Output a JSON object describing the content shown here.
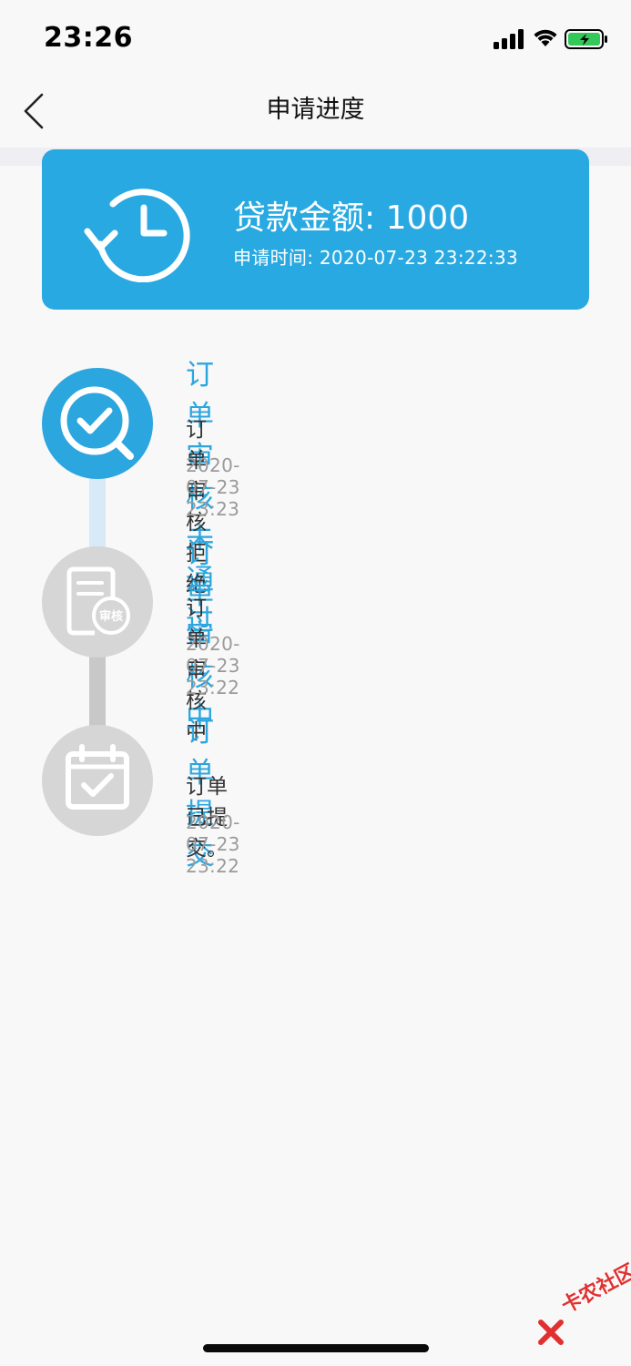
{
  "status_bar": {
    "time": "23:26",
    "icons": [
      "cellular-signal-icon",
      "wifi-icon",
      "battery-charging-icon"
    ],
    "battery_color": "#34c759"
  },
  "nav": {
    "title": "申请进度",
    "back_icon": "chevron-left-icon"
  },
  "summary": {
    "icon": "history-clock-icon",
    "loan_amount": "贷款金额: 1000",
    "apply_time": "申请时间: 2020-07-23 23:22:33",
    "background_color": "#29a9e1"
  },
  "steps": [
    {
      "title": "订单审核未通过",
      "desc": "订单审核拒绝",
      "time": "2020-07-23 23:23",
      "icon": "magnifier-check-icon",
      "active": true
    },
    {
      "title": "订单审核中",
      "desc": "订单审核中",
      "time": "2020-07-23 23:22",
      "icon": "document-review-icon",
      "icon_label": "审核",
      "active": false
    },
    {
      "title": "订单提交",
      "desc": "订单已提交。",
      "time": "2020-07-23 23:22",
      "icon": "calendar-check-icon",
      "active": false
    }
  ],
  "colors": {
    "accent": "#2ba6df",
    "inactive": "#d6d6d6",
    "connector_active": "#d8e9f8",
    "connector_inactive": "#c8c8c8"
  },
  "watermark": {
    "text": "卡农社区"
  }
}
